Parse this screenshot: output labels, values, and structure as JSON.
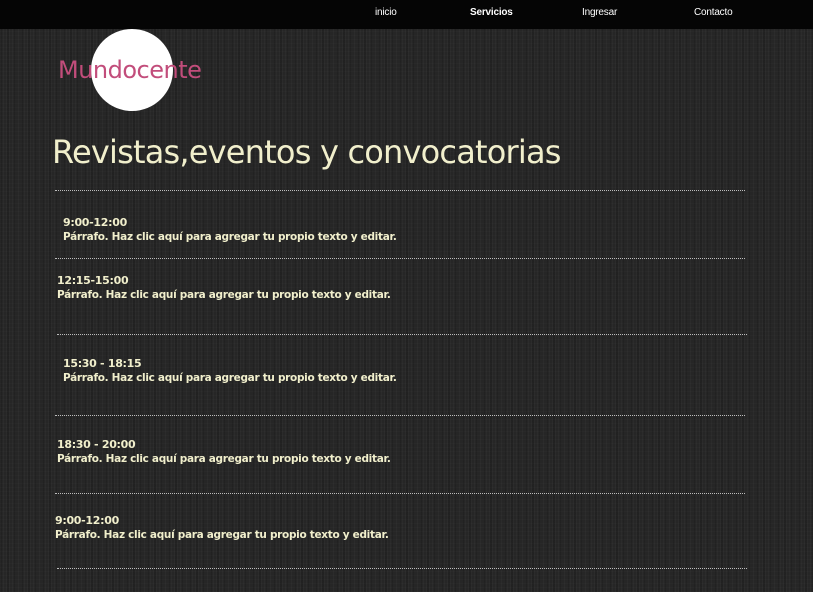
{
  "nav": {
    "items": [
      {
        "label": "inicio"
      },
      {
        "label": "Servicios"
      },
      {
        "label": "Ingresar"
      },
      {
        "label": "Contacto"
      }
    ]
  },
  "logo": {
    "text": "Mundocente",
    "color": "#c24d7b"
  },
  "main": {
    "title": "Revistas,eventos y convocatorias",
    "entries": [
      {
        "time": "9:00-12:00",
        "text": "Párrafo. Haz clic aquí para agregar tu propio texto y editar."
      },
      {
        "time": "12:15-15:00",
        "text": "Párrafo. Haz clic aquí para agregar tu propio texto y editar."
      },
      {
        "time": "15:30 - 18:15",
        "text": "Párrafo. Haz clic aquí para agregar tu propio texto y editar."
      },
      {
        "time": "18:30 - 20:00",
        "text": "Párrafo. Haz clic aquí para agregar tu propio texto y editar."
      },
      {
        "time": "9:00-12:00",
        "text": "Párrafo. Haz clic aquí para agregar tu propio texto y editar."
      }
    ]
  },
  "colors": {
    "text": "#f1efcc",
    "topbar": "#050505",
    "background": "#262626"
  }
}
